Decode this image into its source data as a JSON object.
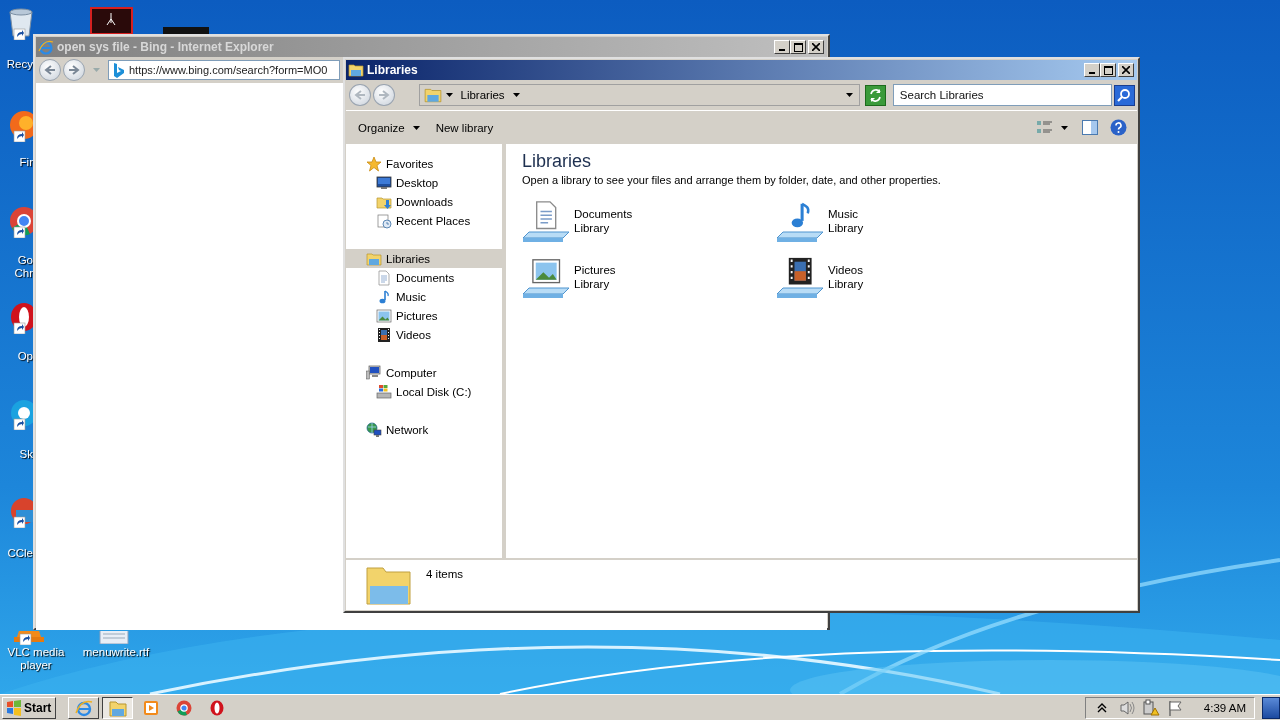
{
  "desktop": {
    "icons": [
      {
        "kind": "recycle-bin",
        "label": "Recy"
      },
      {
        "kind": "firefox",
        "label": "Fir"
      },
      {
        "kind": "chrome",
        "label": "Go Chr"
      },
      {
        "kind": "opera",
        "label": "Op"
      },
      {
        "kind": "skype",
        "label": "Sk"
      },
      {
        "kind": "ccleaner",
        "label": "CCle"
      },
      {
        "kind": "vlc",
        "label": "VLC media player"
      },
      {
        "kind": "document",
        "label": "menuwrite.rtf"
      },
      {
        "kind": "pdf"
      },
      {
        "kind": "dark-app"
      }
    ]
  },
  "ie_window": {
    "title": "open sys file - Bing - Internet Explorer",
    "active": false,
    "address": "https://www.bing.com/search?form=MO0"
  },
  "explorer": {
    "title": "Libraries",
    "active": true,
    "breadcrumb": [
      "Libraries"
    ],
    "search": {
      "placeholder": "Search Libraries"
    },
    "toolbar": [
      {
        "label": "Organize",
        "dropdown": true
      },
      {
        "label": "New library",
        "dropdown": false
      }
    ],
    "navigation": [
      {
        "label": "Favorites",
        "kind": "star",
        "selected": false,
        "children": [
          {
            "label": "Desktop",
            "kind": "desktop",
            "selected": false
          },
          {
            "label": "Downloads",
            "kind": "downloads",
            "selected": false
          },
          {
            "label": "Recent Places",
            "kind": "recent",
            "selected": false
          }
        ]
      },
      {
        "label": "Libraries",
        "kind": "library",
        "selected": true,
        "children": [
          {
            "label": "Documents",
            "kind": "document",
            "selected": false
          },
          {
            "label": "Music",
            "kind": "music",
            "selected": false
          },
          {
            "label": "Pictures",
            "kind": "pictures",
            "selected": false
          },
          {
            "label": "Videos",
            "kind": "videos",
            "selected": false
          }
        ]
      },
      {
        "label": "Computer",
        "kind": "computer",
        "selected": false,
        "children": [
          {
            "label": "Local Disk (C:)",
            "kind": "disk",
            "selected": false
          }
        ]
      },
      {
        "label": "Network",
        "kind": "network",
        "selected": false
      }
    ],
    "content": {
      "title": "Libraries",
      "description": "Open a library to see your files and arrange them by folder, date, and other properties.",
      "libraries": [
        {
          "name": "Documents",
          "subtitle": "Library",
          "kind": "document"
        },
        {
          "name": "Music",
          "subtitle": "Library",
          "kind": "music"
        },
        {
          "name": "Pictures",
          "subtitle": "Library",
          "kind": "pictures"
        },
        {
          "name": "Videos",
          "subtitle": "Library",
          "kind": "videos"
        }
      ]
    },
    "details": {
      "item_count": "4 items"
    }
  },
  "taskbar": {
    "start": {
      "label": "Start"
    },
    "apps": [
      {
        "kind": "ie",
        "running": true,
        "selected": false
      },
      {
        "kind": "explorer",
        "running": true,
        "selected": true
      },
      {
        "kind": "media",
        "running": false,
        "selected": false
      },
      {
        "kind": "chrome",
        "running": false,
        "selected": false
      },
      {
        "kind": "opera",
        "running": false,
        "selected": false
      }
    ],
    "tray": {
      "icons": [
        {
          "kind": "chevron"
        },
        {
          "kind": "speaker"
        },
        {
          "kind": "network"
        },
        {
          "kind": "flag"
        }
      ],
      "clock": "4:39 AM"
    }
  }
}
